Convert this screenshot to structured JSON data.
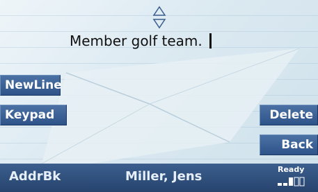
{
  "editor": {
    "text": "Member golf team."
  },
  "softkeys": {
    "newline_label": "NewLine",
    "keypad_label": "Keypad",
    "delete_label": "Delete",
    "back_label": "Back"
  },
  "status_bar": {
    "addrbk_label": "AddrBk",
    "contact_name": "Miller, Jens",
    "status_text": "Ready",
    "signal_bars_active": 3,
    "signal_bars_total": 5
  },
  "icons": {
    "scroll": "up-down-outline-arrows",
    "signal": "signal-strength-bars"
  },
  "colors": {
    "softkey_blue": "#2d5389",
    "status_bar_blue": "#26436d",
    "background": "#dbe9f1"
  }
}
